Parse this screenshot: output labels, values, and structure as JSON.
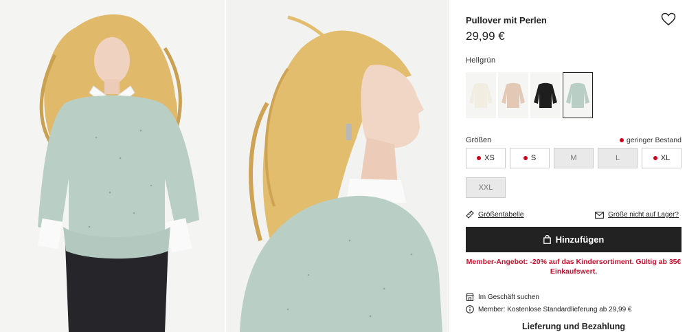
{
  "product": {
    "title": "Pullover mit Perlen",
    "price": "29,99 €",
    "color_name": "Hellgrün",
    "favorite_icon": "heart-icon"
  },
  "swatches": [
    {
      "name": "cream",
      "color": "#f1ede0"
    },
    {
      "name": "beige",
      "color": "#e3c8b6"
    },
    {
      "name": "black",
      "color": "#1e1e1e"
    },
    {
      "name": "light-green",
      "color": "#b9cfc5",
      "selected": true
    }
  ],
  "sizes": {
    "label": "Größen",
    "stock_note": "geringer Bestand",
    "stock_color": "#d0021b",
    "items": [
      {
        "label": "XS",
        "low_stock": true,
        "sold_out": false
      },
      {
        "label": "S",
        "low_stock": true,
        "sold_out": false
      },
      {
        "label": "M",
        "low_stock": false,
        "sold_out": true
      },
      {
        "label": "L",
        "low_stock": false,
        "sold_out": true
      },
      {
        "label": "XL",
        "low_stock": true,
        "sold_out": false
      },
      {
        "label": "XXL",
        "low_stock": false,
        "sold_out": true
      }
    ]
  },
  "links": {
    "size_table": "Größentabelle",
    "not_in_stock": "Größe nicht auf Lager?"
  },
  "add_button": {
    "label": "Hinzufügen",
    "icon": "bag-icon"
  },
  "member_offer": "Member-Angebot: -20% auf das Kindersortiment. Gültig ab 35€ Einkaufswert.",
  "info": {
    "store_search": "Im Geschäft suchen",
    "member_delivery": "Member: Kostenlose Standardlieferung ab 29,99 €",
    "delivery_heading": "Lieferung und Bezahlung"
  },
  "colors": {
    "accent": "#222222",
    "offer_red": "#c4102b",
    "sweater": "#b9cfc5",
    "hair": "#e0b96a"
  }
}
